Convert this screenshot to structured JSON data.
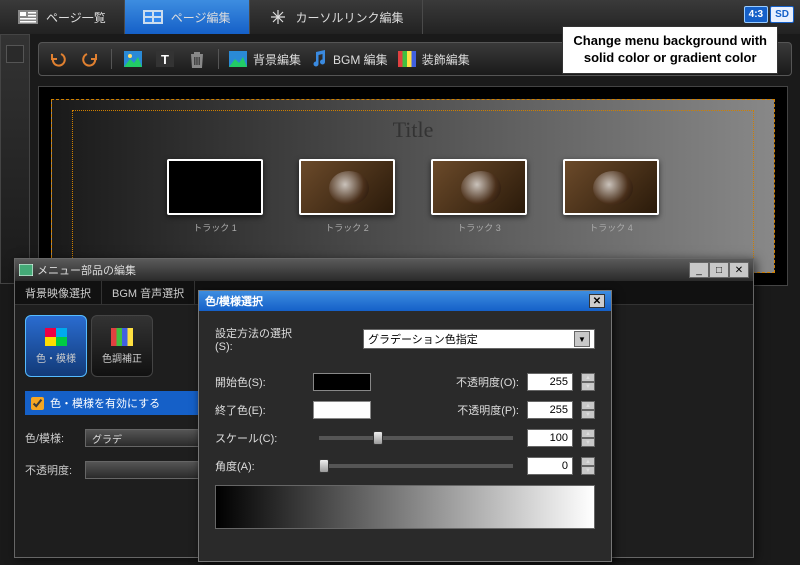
{
  "topTabs": {
    "pageList": "ページ一覧",
    "pageEdit": "ページ編集",
    "cursorLinkEdit": "カーソルリンク編集"
  },
  "aspect": {
    "ratio": "4:3",
    "def": "SD"
  },
  "callout": {
    "line1": "Change menu background with",
    "line2": "solid color or gradient color"
  },
  "toolbar": {
    "bgEdit": "背景編集",
    "bgmEdit": "BGM 編集",
    "decoEdit": "装飾編集"
  },
  "canvas": {
    "title": "Title",
    "tracks": [
      "トラック 1",
      "トラック 2",
      "トラック 3",
      "トラック 4"
    ]
  },
  "modal": {
    "title": "メニュー部品の編集",
    "tabs": {
      "bgVideo": "背景映像選択",
      "bgmAudio": "BGM 音声選択"
    },
    "tiles": {
      "colorPattern": "色・模様",
      "toneCorrect": "色調補正"
    },
    "enableLabel": "色・模様を有効にする",
    "row1Label": "色/模様:",
    "row1Value": "グラデ",
    "row2Label": "不透明度:"
  },
  "inner": {
    "title": "色/模様選択",
    "methodLabel": "設定方法の選択(S):",
    "methodValue": "グラデーション色指定",
    "startColorLabel": "開始色(S):",
    "endColorLabel": "終了色(E):",
    "opacityLabelO": "不透明度(O):",
    "opacityLabelP": "不透明度(P):",
    "scaleLabel": "スケール(C):",
    "angleLabel": "角度(A):",
    "opacityO": "255",
    "opacityP": "255",
    "scale": "100",
    "angle": "0"
  }
}
